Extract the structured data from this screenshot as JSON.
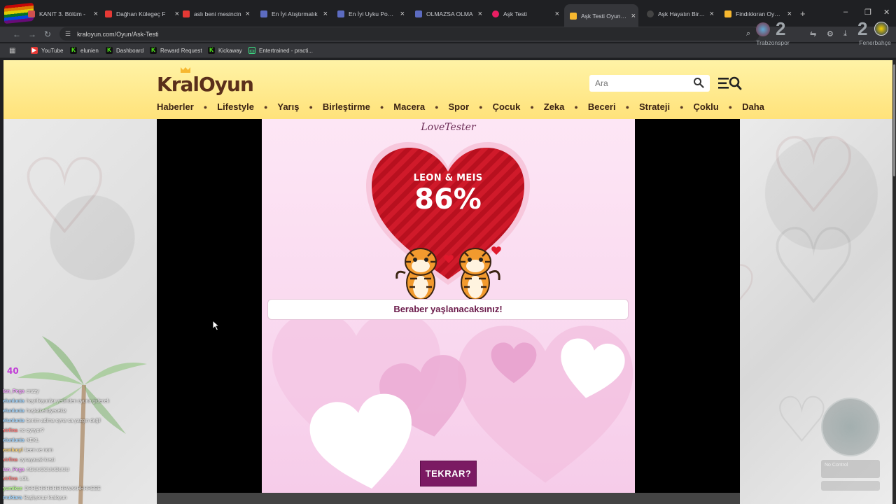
{
  "browser": {
    "tabs": [
      {
        "label": "KANIT 3. Bölüm -",
        "fav_color": "#d05050"
      },
      {
        "label": "Dağhan Külegeç F",
        "fav_color": "#e53935"
      },
      {
        "label": "aslı beni mesincin",
        "fav_color": "#e53935"
      },
      {
        "label": "En İyi Atıştırmalık",
        "fav_color": "#5c6bc0"
      },
      {
        "label": "En İyi Uyku Pozisy",
        "fav_color": "#5c6bc0"
      },
      {
        "label": "OLMAZSA OLMA",
        "fav_color": "#5c6bc0"
      },
      {
        "label": "Aşk Testi",
        "fav_color": "#e91e63"
      },
      {
        "label": "Aşk Testi Oyunu -",
        "fav_color": "#f6b72f"
      },
      {
        "label": "Aşk Hayatın Bir Yı",
        "fav_color": "#444444"
      },
      {
        "label": "Findıkkıran Oyunu",
        "fav_color": "#f6b72f"
      }
    ],
    "url": "kraloyun.com/Oyun/Ask-Testi",
    "bookmarks": [
      {
        "label": "YouTube",
        "icon": "youtube-icon",
        "color": "#e53935"
      },
      {
        "label": "elunien",
        "icon": "kick-icon",
        "color": "#53fc18"
      },
      {
        "label": "Dashboard",
        "icon": "kick-icon",
        "color": "#53fc18"
      },
      {
        "label": "Reward Request",
        "icon": "kick-icon",
        "color": "#53fc18"
      },
      {
        "label": "Kickaway",
        "icon": "kick-icon",
        "color": "#53fc18"
      },
      {
        "label": "Entertrained - practi...",
        "icon": "tv-icon",
        "color": "#3ddc84"
      }
    ]
  },
  "overlay": {
    "team_left": {
      "name": "Trabzonspor",
      "score": "2"
    },
    "team_right": {
      "name": "Fenerbahçe",
      "score": "2"
    },
    "viewers": "40",
    "chat": [
      {
        "name": "Ian_Pega",
        "text": "cnzzy",
        "color": "#f3a3ff"
      },
      {
        "name": "elunlunia",
        "text": "hayirlioyunlar yedinden oyuna gidecek",
        "color": "#9ed4ff"
      },
      {
        "name": "elunlunia",
        "text": "hoşkakendyecekiz",
        "color": "#9ed4ff"
      },
      {
        "name": "elunlunia",
        "text": "benim adima oyna sa yazgın değil",
        "color": "#9ed4ff"
      },
      {
        "name": "virfina",
        "text": "ne oynyor?",
        "color": "#ff7a7a"
      },
      {
        "name": "elunlunia",
        "text": "KEKL",
        "color": "#9ed4ff"
      },
      {
        "name": "eonlucyl",
        "text": "keen ve nom",
        "color": "#ffd36e"
      },
      {
        "name": "virfina",
        "text": "oynayacak krezi",
        "color": "#ff7a7a"
      },
      {
        "name": "Ian_Pega",
        "text": "AGUUCCUUOUUU",
        "color": "#f3a3ff"
      },
      {
        "name": "virfina",
        "text": "LOL",
        "color": "#ff7a7a"
      },
      {
        "name": "yumikse",
        "text": "DHHDHHHHHHHHAAKHHHHEEE",
        "color": "#b4ff8a"
      },
      {
        "name": "muktara",
        "text": "Başlıyoruz kraloyun",
        "color": "#9ed4ff"
      }
    ],
    "control_text": "No Control"
  },
  "site": {
    "logo": "KralOyun",
    "search_placeholder": "Ara",
    "nav": [
      "Haberler",
      "Lifestyle",
      "Yarış",
      "Birleştirme",
      "Macera",
      "Spor",
      "Çocuk",
      "Zeka",
      "Beceri",
      "Strateji",
      "Çoklu",
      "Daha"
    ]
  },
  "game": {
    "title": "LoveTester",
    "names": "LEON & MEIS",
    "percent": "86%",
    "result": "Beraber yaşlanacaksınız!",
    "again_button": "TEKRAR?",
    "heart_color": "#d01a2a",
    "button_color": "#7b1a63"
  }
}
